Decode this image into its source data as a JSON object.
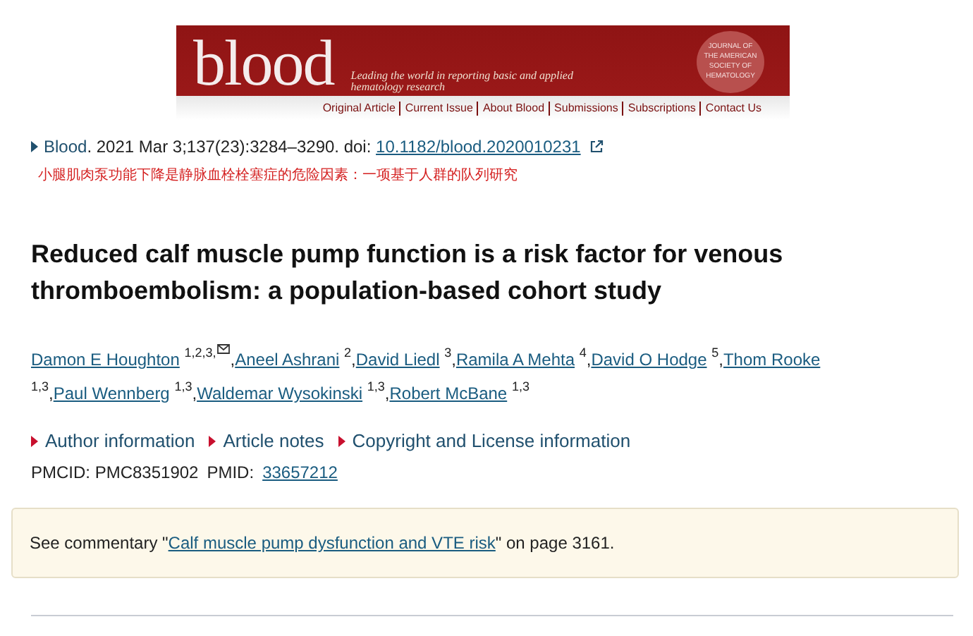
{
  "banner": {
    "logo": "blood",
    "tagline": "Leading the world in reporting basic and applied hematology research",
    "society": [
      "JOURNAL OF",
      "THE AMERICAN",
      "SOCIETY OF",
      "HEMATOLOGY"
    ],
    "nav": [
      "Original Article",
      "Current Issue",
      "About Blood",
      "Submissions",
      "Subscriptions",
      "Contact Us"
    ]
  },
  "citation": {
    "journal": "Blood",
    "details": ". 2021 Mar 3;137(23):3284–3290. doi: ",
    "doi": "10.1182/blood.2020010231"
  },
  "translation": "小腿肌肉泵功能下降是静脉血栓栓塞症的危险因素：一项基于人群的队列研究",
  "title": "Reduced calf muscle pump function is a risk factor for venous thromboembolism: a population-based cohort study",
  "authors": [
    {
      "name": "Damon E Houghton",
      "affil": "1,2,3,",
      "contact": true,
      "separator": ","
    },
    {
      "name": "Aneel Ashrani",
      "affil": "2",
      "contact": false,
      "separator": ","
    },
    {
      "name": "David Liedl",
      "affil": "3",
      "contact": false,
      "separator": ","
    },
    {
      "name": "Ramila A Mehta",
      "affil": "4",
      "contact": false,
      "separator": ","
    },
    {
      "name": "David O Hodge",
      "affil": "5",
      "contact": false,
      "separator": ","
    },
    {
      "name": "Thom Rooke",
      "affil": "1,3",
      "contact": false,
      "separator": ","
    },
    {
      "name": "Paul Wennberg",
      "affil": "1,3",
      "contact": false,
      "separator": ","
    },
    {
      "name": "Waldemar Wysokinski",
      "affil": "1,3",
      "contact": false,
      "separator": ","
    },
    {
      "name": "Robert McBane",
      "affil": "1,3",
      "contact": false
    }
  ],
  "sections": [
    "Author information",
    "Article notes",
    "Copyright and License information"
  ],
  "ids": {
    "pmcid_label": "PMCID:",
    "pmcid": "PMC8351902",
    "pmid_label": "PMID:",
    "pmid": "33657212"
  },
  "commentary": {
    "prefix": "See commentary \"",
    "link": "Calf muscle pump dysfunction and VTE risk",
    "suffix": "\" on page 3161."
  }
}
